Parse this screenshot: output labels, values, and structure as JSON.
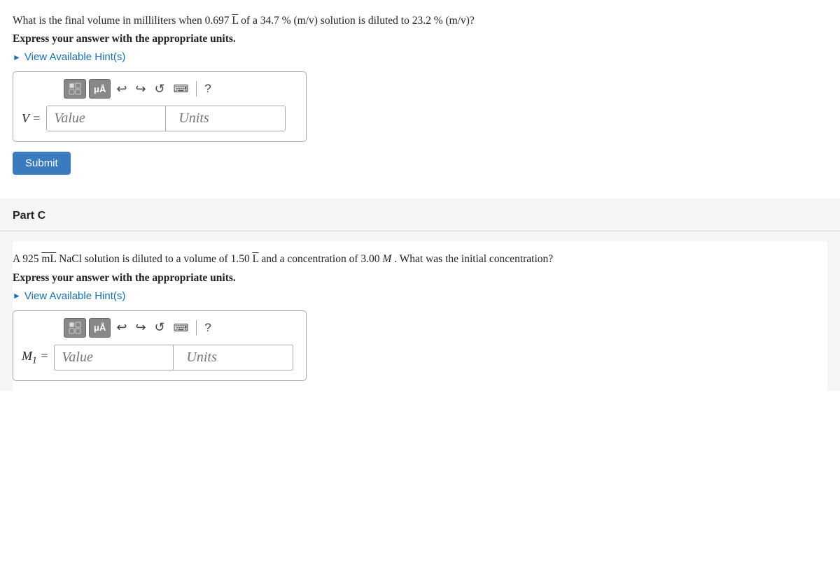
{
  "partB": {
    "question": "What is the final volume in milliliters when 0.697 L of a 34.7 % (m/v) solution is diluted to 23.2 % (m/v)?",
    "express": "Express your answer with the appropriate units.",
    "hint_link": "View Available Hint(s)",
    "variable": "V =",
    "value_placeholder": "Value",
    "units_placeholder": "Units",
    "submit_label": "Submit"
  },
  "partC": {
    "part_label": "Part C",
    "question_intro": "A 925 mL NaCl solution is diluted to a volume of 1.50 L and a concentration of 3.00",
    "question_m": "M",
    "question_end": ". What was the initial concentration?",
    "express": "Express your answer with the appropriate units.",
    "hint_link": "View Available Hint(s)",
    "variable": "M₁ =",
    "value_placeholder": "Value",
    "units_placeholder": "Units"
  },
  "toolbar": {
    "undo_label": "↩",
    "redo_label": "↪",
    "refresh_label": "↺",
    "keyboard_label": "⌨",
    "separator": "|",
    "help_label": "?"
  }
}
